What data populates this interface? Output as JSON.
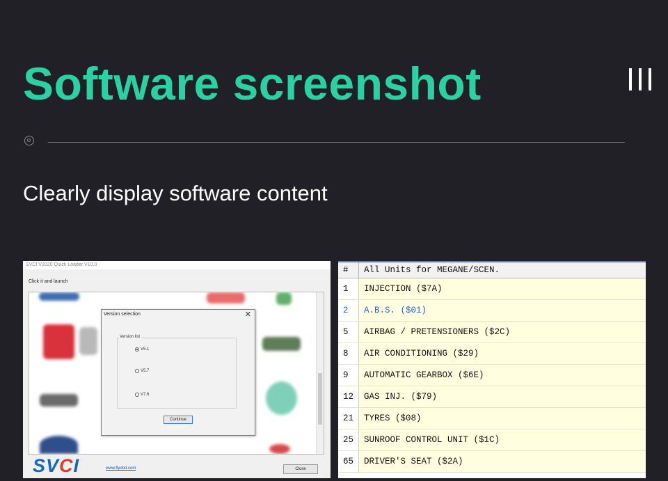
{
  "header": {
    "title": "Software screenshot",
    "subtitle": "Clearly display software content",
    "menu_icon": "menu-bars-icon",
    "divider_icon": "target-circle-icon"
  },
  "colors": {
    "background": "#212026",
    "accent": "#2ad1a3",
    "selected_row_text": "#2a5fc9",
    "table_row_bg": "#ffffe0"
  },
  "loader": {
    "window_title": "SVCI V2020 Quick Loader V10.0",
    "instruction": "Click it and launch",
    "dialog": {
      "title": "Version selection",
      "close": "✕",
      "group_label": "Version list",
      "options": [
        {
          "label": "V5.1",
          "checked": true
        },
        {
          "label": "V5.7",
          "checked": false
        },
        {
          "label": "V7.6",
          "checked": false
        }
      ],
      "continue_label": "Continue"
    },
    "logo": "SVCI",
    "link": "www.flyobd.com",
    "close_label": "Close"
  },
  "units": {
    "columns": [
      "#",
      "All Units for MEGANE/SCEN."
    ],
    "rows": [
      {
        "num": "1",
        "name": "INJECTION ($7A)",
        "selected": false
      },
      {
        "num": "2",
        "name": "A.B.S. ($01)",
        "selected": true
      },
      {
        "num": "5",
        "name": "AIRBAG / PRETENSIONERS ($2C)",
        "selected": false
      },
      {
        "num": "8",
        "name": "AIR CONDITIONING ($29)",
        "selected": false
      },
      {
        "num": "9",
        "name": "AUTOMATIC GEARBOX ($6E)",
        "selected": false
      },
      {
        "num": "12",
        "name": "GAS INJ. ($79)",
        "selected": false
      },
      {
        "num": "21",
        "name": "TYRES ($08)",
        "selected": false
      },
      {
        "num": "25",
        "name": "SUNROOF CONTROL UNIT ($1C)",
        "selected": false
      },
      {
        "num": "65",
        "name": "DRIVER'S SEAT ($2A)",
        "selected": false
      }
    ]
  }
}
